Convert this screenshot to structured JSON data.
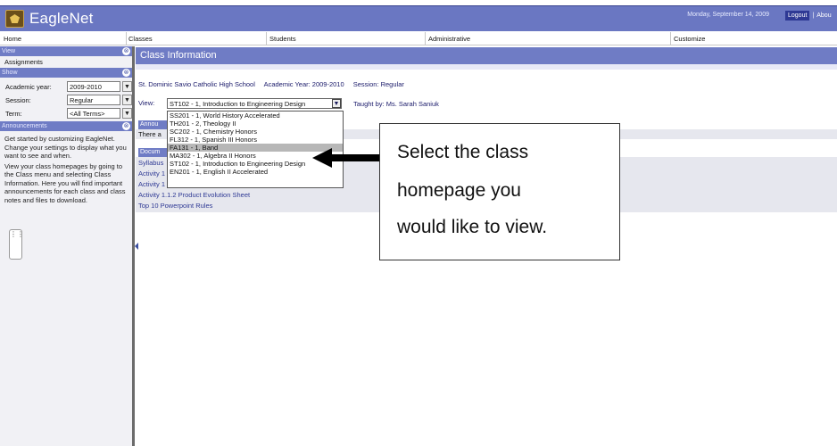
{
  "header": {
    "app_name": "EagleNet",
    "date": "Monday, September 14, 2009",
    "logout": "Logout",
    "separator": "|",
    "about": "Abou"
  },
  "menu": [
    "Home",
    "Classes",
    "Students",
    "Administrative",
    "Customize"
  ],
  "sidebar": {
    "view_title": "View",
    "assignments": "Assignments",
    "show_title": "Show",
    "academic_year_label": "Academic year:",
    "academic_year_value": "2009-2010",
    "session_label": "Session:",
    "session_value": "Regular",
    "term_label": "Term:",
    "term_value": "<All Terms>",
    "announcements_title": "Announcements",
    "announce_p1": "Get started by customizing EagleNet. Change your settings to display what you want to see and when.",
    "announce_p2": "View your class homepages by going to the Class menu and selecting Class Information. Here you will find important announcements for each class and class notes and files to download."
  },
  "main": {
    "title": "Class Information",
    "school": "St. Dominic Savio Catholic High School",
    "academic_year": "Academic Year: 2009-2010",
    "session": "Session: Regular",
    "view_label": "View:",
    "view_selected": "ST102 - 1, Introduction to Engineering Design",
    "taught_by": "Taught by: Ms. Sarah Saniuk",
    "announcements_head": "Annou",
    "announcements_text": "There a",
    "documents_head": "Docum",
    "documents": [
      "Syllabus",
      "Activity 1",
      "Activity 1",
      "Activity 1.1.2 Product Evolution Sheet",
      "Top 10 Powerpoint Rules"
    ]
  },
  "dropdown_options": [
    "SS201 - 1, World History Accelerated",
    "TH201 - 2, Theology II",
    "SC202 - 1, Chemistry Honors",
    "FL312 - 1, Spanish III Honors",
    "FA131 - 1, Band",
    "MA302 - 1, Algebra II Honors",
    "ST102 - 1, Introduction to Engineering Design",
    "EN201 - 1, English II Accelerated"
  ],
  "dropdown_highlighted_index": 4,
  "callout": {
    "line1": "Select the class",
    "line2": "homepage you",
    "line3": "would like to view."
  },
  "icons": {
    "collapse": "⊗",
    "dropdown_arrow": "▼",
    "grip": "⋮⋮"
  },
  "colors": {
    "header": "#6a77c2",
    "section_head": "#6f7cc5",
    "highlight": "#b7b7b7"
  }
}
